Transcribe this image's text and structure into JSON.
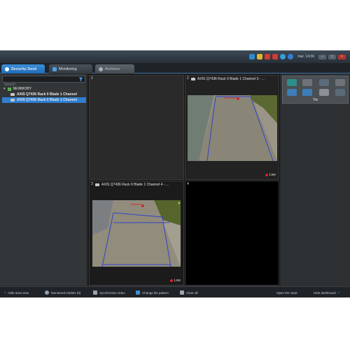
{
  "colors": {
    "accent": "#2f7fd1",
    "live": "#e02020",
    "video_road": "#8c8a80",
    "video_grass": "#5f6b34"
  },
  "system_tray": {
    "clock": "mar. 14:36"
  },
  "tabs": [
    {
      "label": "Security Desk",
      "icon": "home-icon"
    },
    {
      "label": "Monitoring",
      "icon": "monitor-icon"
    },
    {
      "label": "Archives",
      "icon": "archive-icon"
    }
  ],
  "search": {
    "placeholder": "Search"
  },
  "tree": {
    "root": "NEWMOBY",
    "items": [
      {
        "label": "AXIS Q7436 Rack 0 Blade 1 Channel"
      },
      {
        "label": "AXIS Q7436 Rack 0 Blade 1 Channel"
      }
    ]
  },
  "tiles": [
    {
      "number": "1",
      "title": ""
    },
    {
      "number": "2",
      "title": "AXIS Q7436 Rack 0 Blade 1 Channel 3 - ...",
      "live": "Live"
    },
    {
      "number": "3",
      "title": "AXIS Q7436 Rack 0 Blade 1 Channel 4 - ...",
      "live": "Live"
    },
    {
      "number": "4",
      "title": ""
    }
  ],
  "dashboard": {
    "tile_label": "Tile"
  },
  "bottombar": {
    "hide_area": "Hide area view",
    "monitored": "Monitored entities (0)",
    "sync_video": "Synchronize video",
    "change_pattern": "Change tile pattern",
    "clear_all": "Clear all",
    "open_vault": "Open the Vault",
    "hide_dashboard": "Hide dashboard"
  }
}
